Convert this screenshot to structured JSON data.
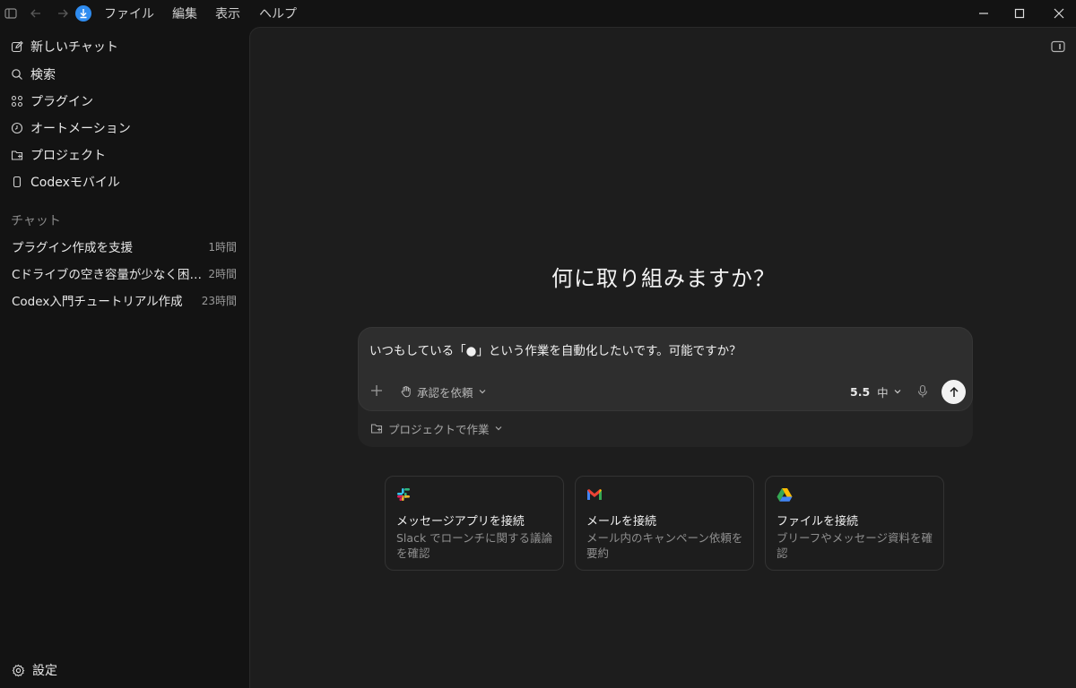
{
  "menu": {
    "file": "ファイル",
    "edit": "編集",
    "view": "表示",
    "help": "ヘルプ"
  },
  "sidebar": {
    "nav": [
      {
        "label": "新しいチャット",
        "icon": "edit-icon"
      },
      {
        "label": "検索",
        "icon": "search-icon"
      },
      {
        "label": "プラグイン",
        "icon": "plugins-icon"
      },
      {
        "label": "オートメーション",
        "icon": "clock-icon"
      },
      {
        "label": "プロジェクト",
        "icon": "folder-icon"
      },
      {
        "label": "Codexモバイル",
        "icon": "mobile-icon"
      }
    ],
    "chats_label": "チャット",
    "chats": [
      {
        "title": "プラグイン作成を支援",
        "time": "1時間"
      },
      {
        "title": "Cドライブの空き容量が少なく困っています",
        "time": "2時間"
      },
      {
        "title": "Codex入門チュートリアル作成",
        "time": "23時間"
      }
    ],
    "settings_label": "設定"
  },
  "main": {
    "heading": "何に取り組みますか？",
    "composer": {
      "text": "いつもしている「●」という作業を自動化したいです。可能ですか？",
      "approval_label": "承認を依頼",
      "model_version": "5.5",
      "effort": "中"
    },
    "project_label": "プロジェクトで作業",
    "cards": [
      {
        "title": "メッセージアプリを接続",
        "desc": "Slack でローンチに関する議論を確認",
        "icon": "slack-icon"
      },
      {
        "title": "メールを接続",
        "desc": "メール内のキャンペーン依頼を要約",
        "icon": "gmail-icon"
      },
      {
        "title": "ファイルを接続",
        "desc": "ブリーフやメッセージ資料を確認",
        "icon": "google-drive-icon"
      }
    ]
  },
  "colors": {
    "sidebar_bg": "#131313",
    "main_bg": "#1d1d1d",
    "accent_download": "#2f8cf0"
  }
}
